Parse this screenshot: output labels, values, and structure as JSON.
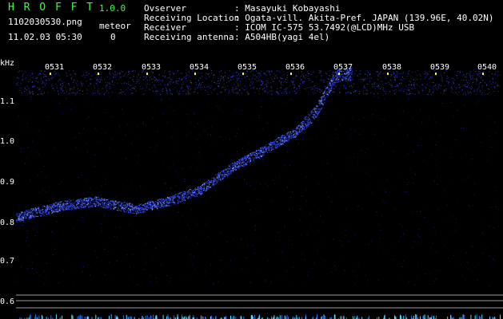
{
  "header": {
    "app_title": "H R O F F T",
    "version": "1.0.0",
    "filename": "1102030530.png",
    "datetime": "11.02.03 05:30",
    "meteor_label": "meteor",
    "meteor_count": "0"
  },
  "info": {
    "observer_label": "Ovserver",
    "observer_value": ": Masayuki Kobayashi",
    "location_label": "Receiving Location",
    "location_value": ": Ogata-vill. Akita-Pref. JAPAN (139.96E, 40.02N)",
    "receiver_label": "Receiver",
    "receiver_value": ": ICOM IC-575 53.7492(@LCD)MHz USB",
    "antenna_label": "Receiving antenna",
    "antenna_value": ": A504HB(yagi 4el)"
  },
  "axis": {
    "unit": "kHz",
    "time_ticks": [
      "0531",
      "0532",
      "0533",
      "0534",
      "0535",
      "0536",
      "0537",
      "0538",
      "0539",
      "0540"
    ],
    "freq_ticks": [
      "1.1",
      "1.0",
      "0.9",
      "0.8",
      "0.7",
      "0.6"
    ]
  },
  "colors": {
    "background": "#000000",
    "title_green": "#3aff3a",
    "signal_blue": "#3355ff",
    "tick_yellow": "#ffff00"
  }
}
